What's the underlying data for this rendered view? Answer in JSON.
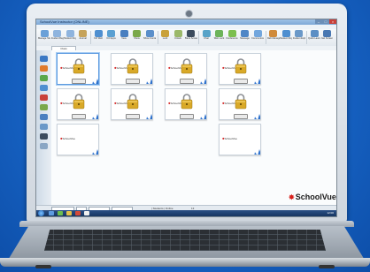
{
  "app": {
    "title": "SchoolVue Instructor (ONLINE)",
    "menus": [
      "School",
      "Group",
      "View",
      "Monitor",
      "Layout",
      "Manage",
      "Journal",
      "Window",
      "Help"
    ]
  },
  "ribbon": [
    {
      "label": "Manage Student",
      "icon": "manage-student-icon",
      "color": "#6aa0d8"
    },
    {
      "label": "Student Register",
      "icon": "student-register-icon",
      "color": "#8fb4de"
    },
    {
      "label": "Student Register",
      "icon": "student-register-icon",
      "color": "#8fb4de"
    },
    {
      "label": "Journal",
      "icon": "journal-icon",
      "color": "#c6a35a"
    },
    {
      "label": "Ctrl Web",
      "icon": "web-icon",
      "color": "#4f8fd0"
    },
    {
      "label": "Ctrl Apps",
      "icon": "apps-icon",
      "color": "#5aa0d2"
    },
    {
      "label": "View",
      "icon": "view-icon",
      "color": "#4a7fc0"
    },
    {
      "label": "Show",
      "icon": "show-icon",
      "color": "#7aa84a"
    },
    {
      "label": "Show Contact Screen",
      "icon": "contact-screen-icon",
      "color": "#5b8fca"
    },
    {
      "label": "Lock",
      "icon": "lock-icon",
      "color": "#c9a13a"
    },
    {
      "label": "Unlock",
      "icon": "unlock-icon",
      "color": "#9bb86a"
    },
    {
      "label": "Blank Screen",
      "icon": "blank-screen-icon",
      "color": "#3d4c5e"
    },
    {
      "label": "Chat",
      "icon": "chat-icon",
      "color": "#58a3c8"
    },
    {
      "label": "Web Lock",
      "icon": "web-lock-icon",
      "color": "#6db35a"
    },
    {
      "label": "Conference",
      "icon": "conference-icon",
      "color": "#7cbf4f"
    },
    {
      "label": "Message",
      "icon": "message-icon",
      "color": "#4f86c6"
    },
    {
      "label": "Communicate",
      "icon": "communicate-icon",
      "color": "#72a6dd"
    },
    {
      "label": "Web Manager",
      "icon": "web-manager-icon",
      "color": "#d08a3a"
    },
    {
      "label": "Student Register",
      "icon": "register-icon",
      "color": "#4f8fd0"
    },
    {
      "label": "Student Explorer",
      "icon": "explorer-icon",
      "color": "#6a98c8"
    },
    {
      "label": "Quick Launch",
      "icon": "quick-launch-icon",
      "color": "#5c8ec4"
    },
    {
      "label": "Get Screen",
      "icon": "screen-icon",
      "color": "#4a78b2"
    }
  ],
  "tabs": [
    "Class"
  ],
  "thumbnails": {
    "brand_prefix": "✸",
    "brand_text": "SchoolVue",
    "count": 13
  },
  "logo": {
    "star": "✸",
    "text": "SchoolVue"
  },
  "statusbar": {
    "field1": "",
    "field2": "",
    "text": "| Students | Online",
    "count": "13"
  },
  "taskbar": {
    "clock": "12:00"
  }
}
